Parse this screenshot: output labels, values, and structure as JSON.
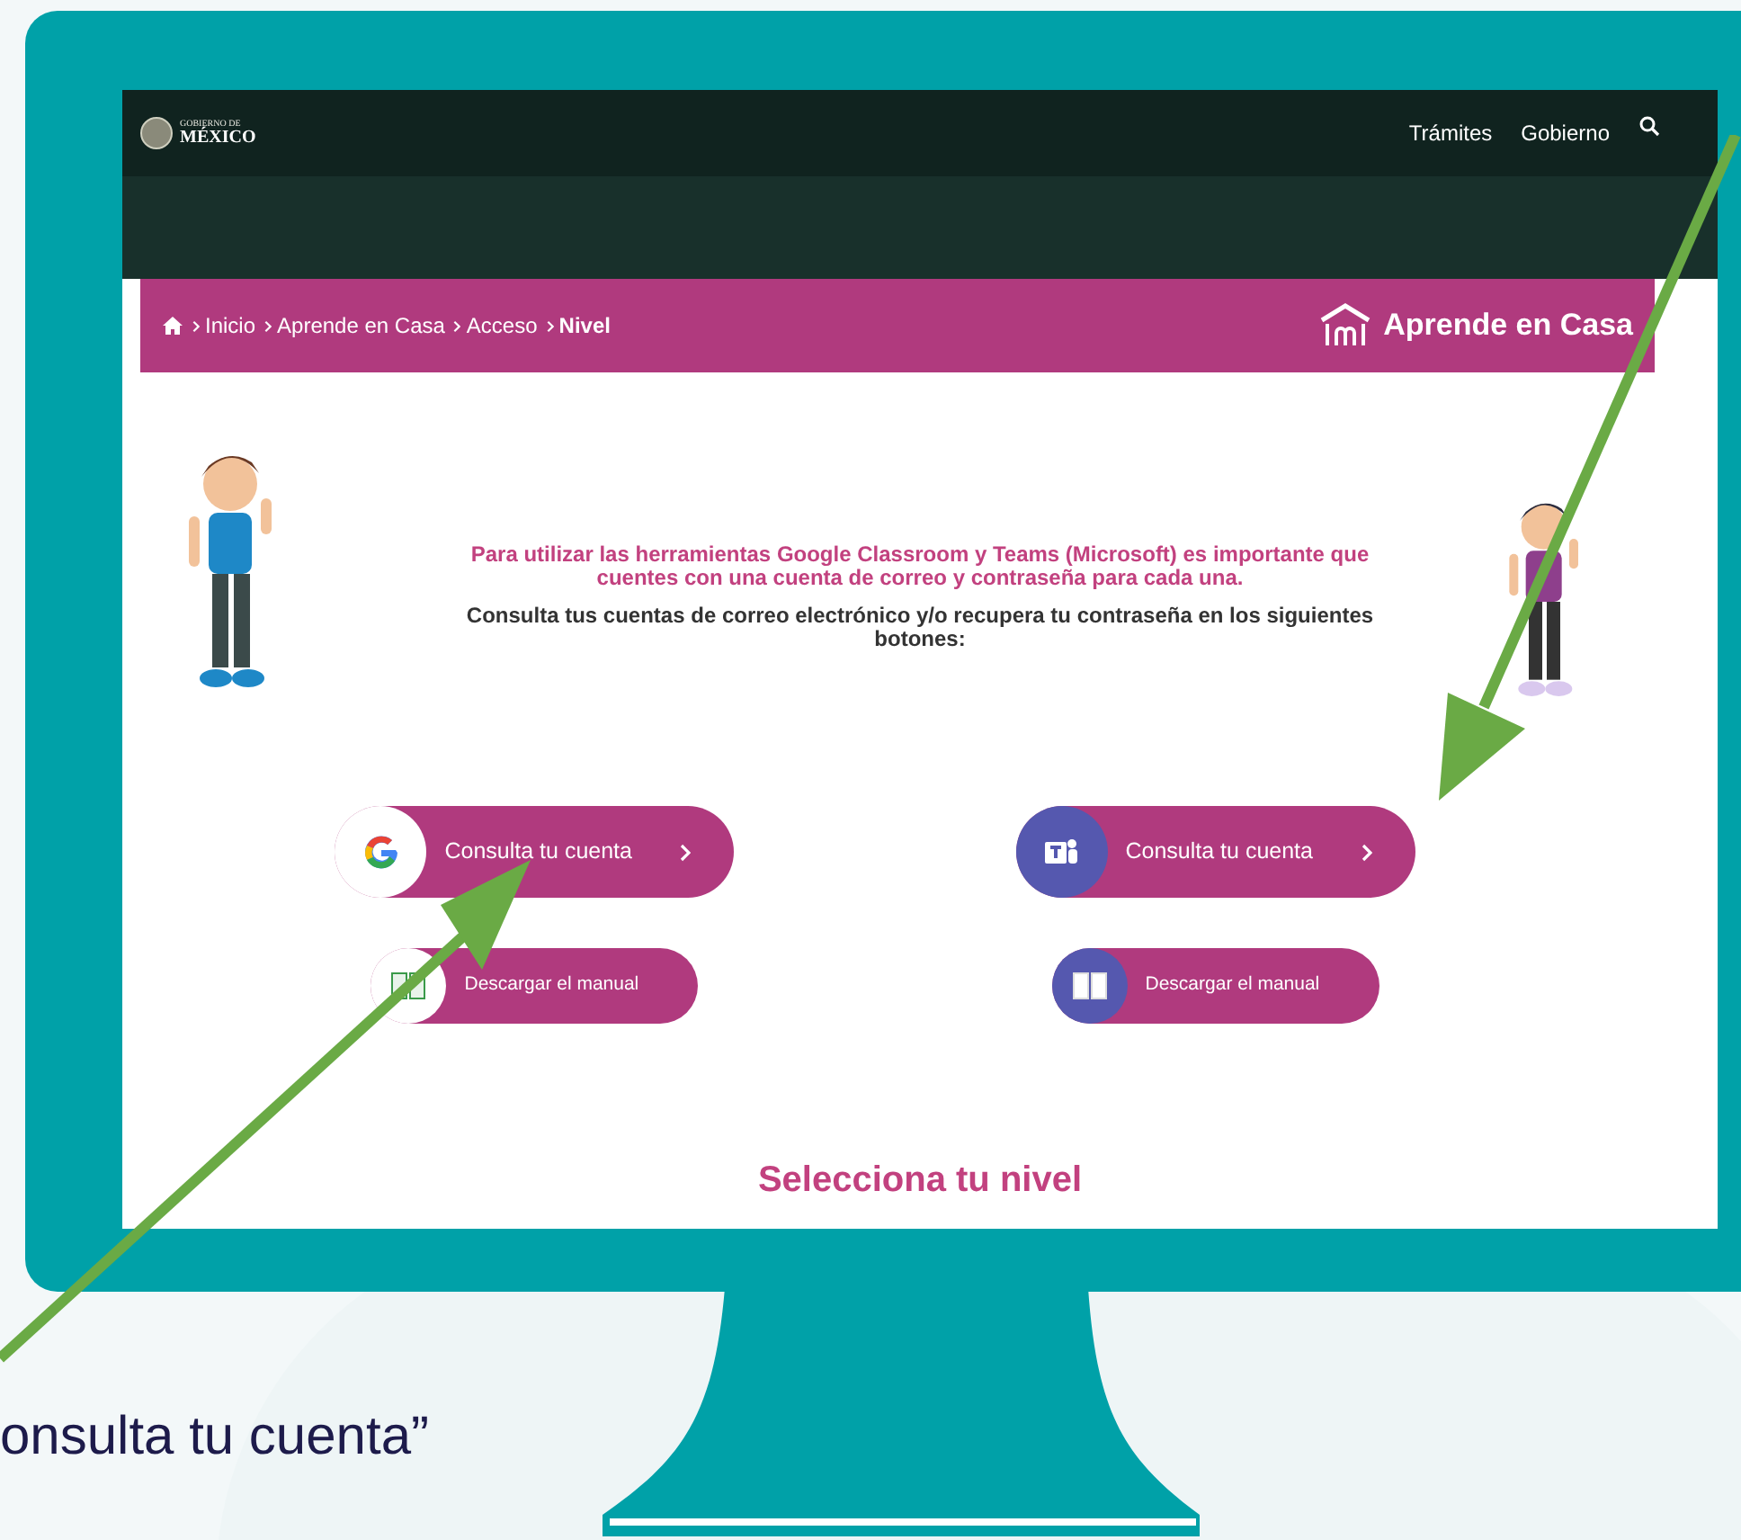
{
  "header": {
    "logo_lines": [
      "GOBIERNO DE",
      "MÉXICO"
    ],
    "nav": [
      "Trámites",
      "Gobierno"
    ]
  },
  "breadcrumb": {
    "items": [
      {
        "label": "Inicio",
        "current": false
      },
      {
        "label": "Aprende en Casa",
        "current": false
      },
      {
        "label": "Acceso",
        "current": false
      },
      {
        "label": "Nivel",
        "current": true
      }
    ],
    "brand": "Aprende en Casa"
  },
  "intro": {
    "highlight": "Para utilizar las herramientas Google Classroom y Teams (Microsoft) es importante que cuentes con una cuenta de correo y contraseña para cada una.",
    "body": "Consulta tus cuentas de correo electrónico y/o recupera tu contraseña en los siguientes botones:"
  },
  "services": [
    {
      "kind": "google",
      "account_button": "Consulta tu cuenta",
      "manual_button": "Descargar el manual"
    },
    {
      "kind": "teams",
      "account_button": "Consulta tu cuenta",
      "manual_button": "Descargar el manual"
    }
  ],
  "section_title": "Selecciona tu nivel",
  "caption": "onsulta tu cuenta”"
}
